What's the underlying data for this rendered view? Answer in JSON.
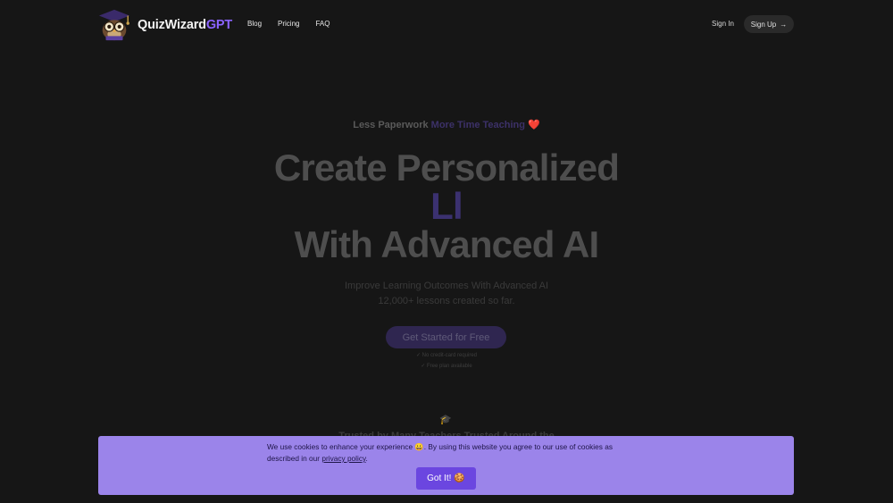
{
  "header": {
    "brand_main": "QuizWizard",
    "brand_accent": "GPT",
    "nav": [
      {
        "label": "Blog"
      },
      {
        "label": "Pricing"
      },
      {
        "label": "FAQ"
      }
    ],
    "sign_in": "Sign In",
    "sign_up": "Sign Up",
    "sign_up_icon": "→"
  },
  "hero": {
    "tagline_part1": "Less Paperwork",
    "tagline_part2": "More Time Teaching",
    "tagline_heart": "❤️",
    "title_line1": "Create Personalized",
    "title_line2": "Ll",
    "title_line3": "With Advanced AI",
    "subtitle_line1": "Improve Learning Outcomes With Advanced AI",
    "subtitle_line2": "12,000+ lessons created so far.",
    "cta_label": "Get Started for Free",
    "note1": "✓ No credit-card required",
    "note2": "✓ Free plan available",
    "cap_icon": "🎓",
    "trusted_text": "Trusted by Many Teachers Trusted Around the"
  },
  "cookie": {
    "text_before": "We use cookies to enhance your experience 😀. By using this website you agree to our use of cookies as described in our",
    "policy_link": "privacy policy",
    "text_after": ".",
    "button_label": "Got It!",
    "button_emoji": "🍪"
  },
  "colors": {
    "background": "#161616",
    "accent": "#8b63ff",
    "cookie_banner": "#9b84ea",
    "cookie_button": "#6b46e0"
  }
}
